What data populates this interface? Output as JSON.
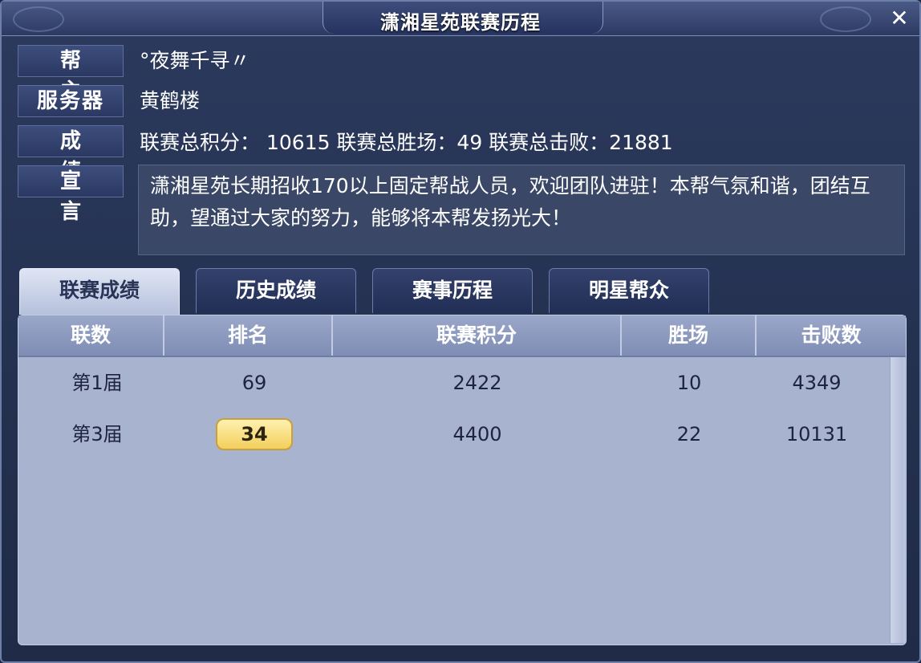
{
  "window": {
    "title": "潇湘星苑联赛历程",
    "close_label": "✕"
  },
  "info": {
    "leader": {
      "label": "帮 主",
      "value": "°夜舞千寻〃"
    },
    "server": {
      "label": "服务器",
      "value": "黄鹤楼"
    },
    "results": {
      "label": "成 绩",
      "value": "联赛总积分： 10615  联赛总胜场：49  联赛总击败：21881"
    },
    "declaration": {
      "label": "宣 言",
      "value": "潇湘星苑长期招收170以上固定帮战人员，欢迎团队进驻！本帮气氛和谐，团结互助，望通过大家的努力，能够将本帮发扬光大！"
    }
  },
  "tabs": [
    {
      "label": "联赛成绩",
      "active": true
    },
    {
      "label": "历史成绩",
      "active": false
    },
    {
      "label": "赛事历程",
      "active": false
    },
    {
      "label": "明星帮众",
      "active": false
    }
  ],
  "table": {
    "columns": [
      "联数",
      "排名",
      "联赛积分",
      "胜场",
      "击败数"
    ],
    "rows": [
      {
        "season": "第1届",
        "rank": "69",
        "points": "2422",
        "wins": "10",
        "defeats": "4349",
        "highlight": false
      },
      {
        "season": "第3届",
        "rank": "34",
        "points": "4400",
        "wins": "22",
        "defeats": "10131",
        "highlight": true
      }
    ]
  },
  "colors": {
    "accent_gold": "#f3cf5c",
    "panel_bg": "#a8b3d0",
    "window_bg": "#23304f"
  }
}
